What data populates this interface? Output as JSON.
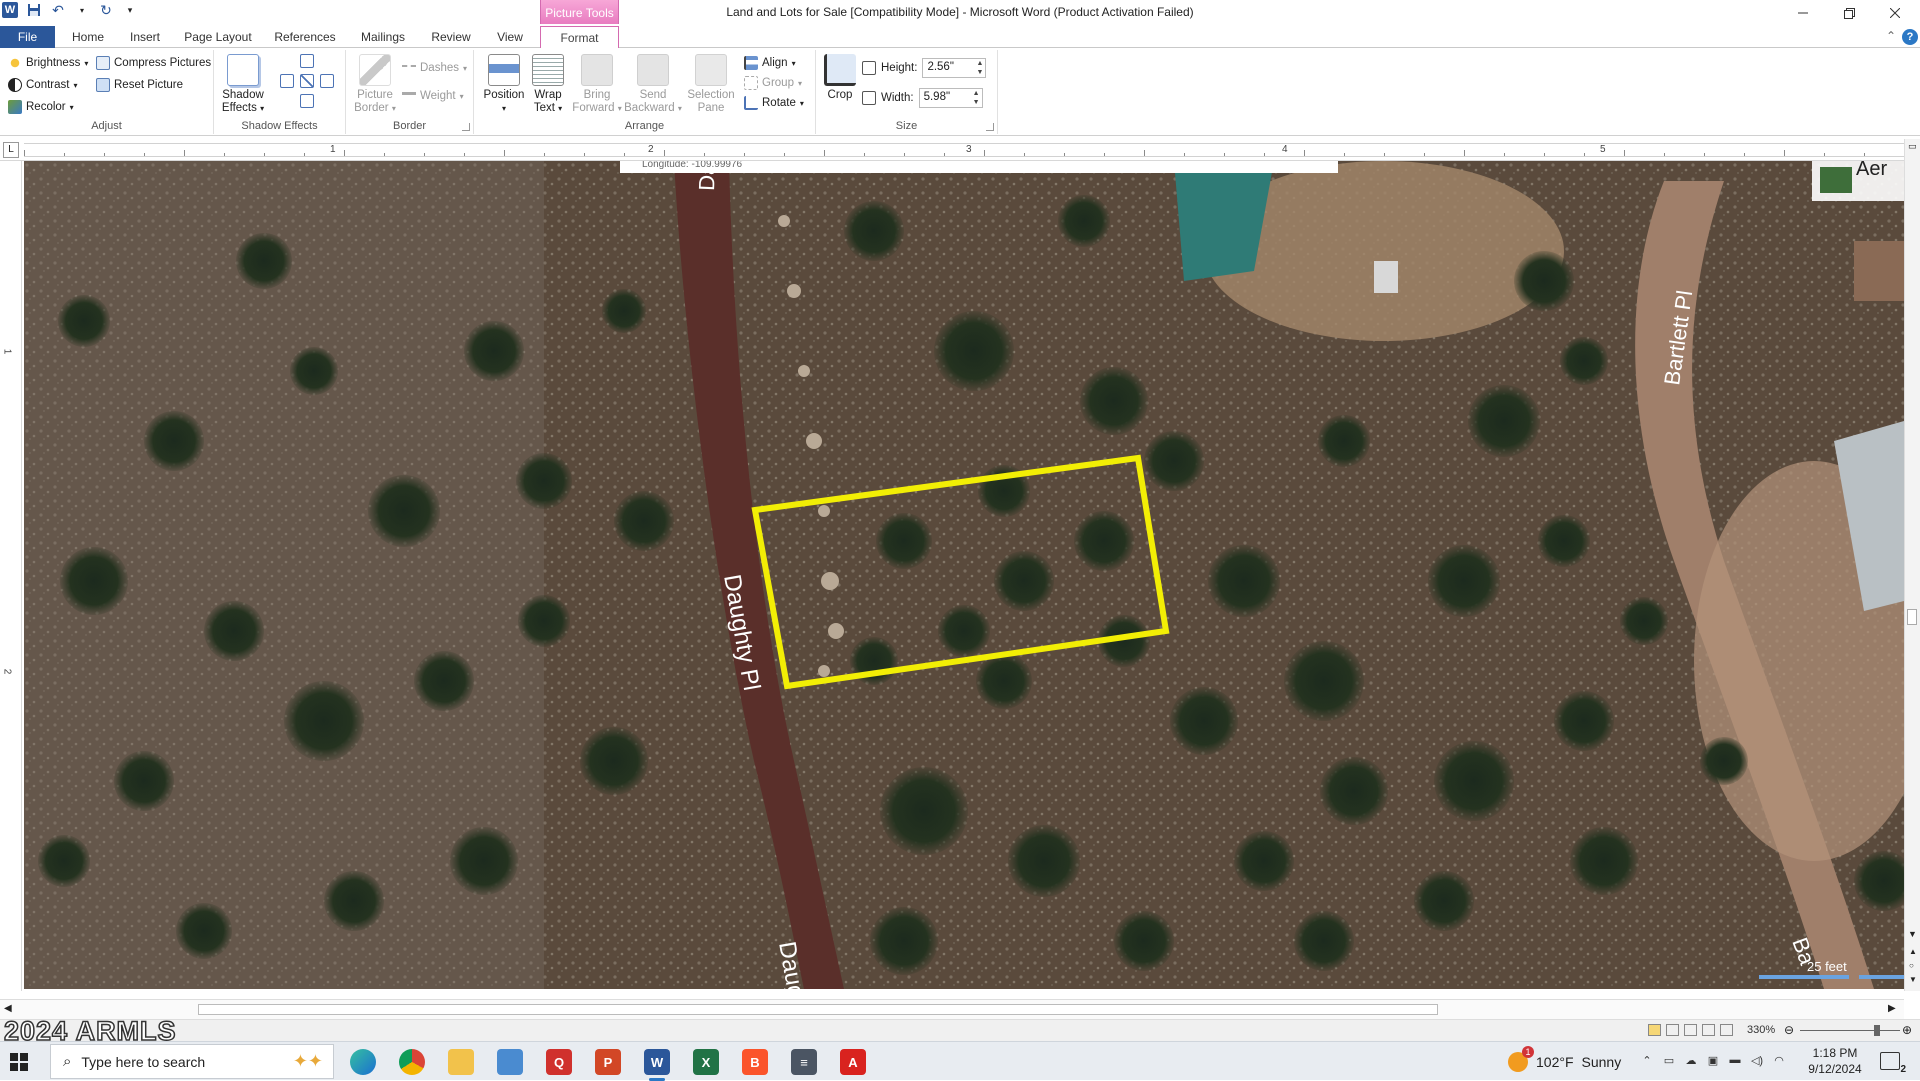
{
  "app": {
    "title": "Land and Lots for Sale [Compatibility Mode]  -  Microsoft Word (Product Activation Failed)",
    "context_group": "Picture Tools"
  },
  "tabs": [
    {
      "label": "File"
    },
    {
      "label": "Home"
    },
    {
      "label": "Insert"
    },
    {
      "label": "Page Layout"
    },
    {
      "label": "References"
    },
    {
      "label": "Mailings"
    },
    {
      "label": "Review"
    },
    {
      "label": "View"
    },
    {
      "label": "Format"
    }
  ],
  "ribbon": {
    "adjust": {
      "label": "Adjust",
      "brightness": "Brightness",
      "contrast": "Contrast",
      "recolor": "Recolor",
      "compress": "Compress Pictures",
      "reset": "Reset Picture"
    },
    "shadow": {
      "label": "Shadow Effects",
      "button_line1": "Shadow",
      "button_line2": "Effects"
    },
    "border": {
      "label": "Border",
      "picture_line1": "Picture",
      "picture_line2": "Border",
      "dashes": "Dashes",
      "weight": "Weight"
    },
    "arrange": {
      "label": "Arrange",
      "position": "Position",
      "wrap_line1": "Wrap",
      "wrap_line2": "Text",
      "bring_line1": "Bring",
      "bring_line2": "Forward",
      "send_line1": "Send",
      "send_line2": "Backward",
      "selection_line1": "Selection",
      "selection_line2": "Pane",
      "align": "Align",
      "group": "Group",
      "rotate": "Rotate"
    },
    "size": {
      "label": "Size",
      "crop": "Crop",
      "height_label": "Height:",
      "height_value": "2.56\"",
      "width_label": "Width:",
      "width_value": "5.98\""
    }
  },
  "ruler": {
    "numbers": [
      "1",
      "2",
      "3",
      "4",
      "5"
    ],
    "vertical_numbers": [
      "1",
      "2"
    ]
  },
  "map": {
    "top_bar_text": "Longitude: -109.99976",
    "streets": [
      "Daughty Pl",
      "Daughty Pl",
      "Daug",
      "Bartlett Pl",
      "Ba"
    ],
    "aerial_label": "Aer",
    "scale_label": "25 feet",
    "lot_outline_color": "#f2ee05"
  },
  "statusbar": {
    "watermark": "2024 ARMLS",
    "zoom": "330%"
  },
  "taskbar": {
    "search_placeholder": "Type here to search",
    "weather_temp": "102°F",
    "weather_condition": "Sunny",
    "weather_badge": "1",
    "time": "1:18 PM",
    "date": "9/12/2024",
    "notification_count": "2"
  }
}
